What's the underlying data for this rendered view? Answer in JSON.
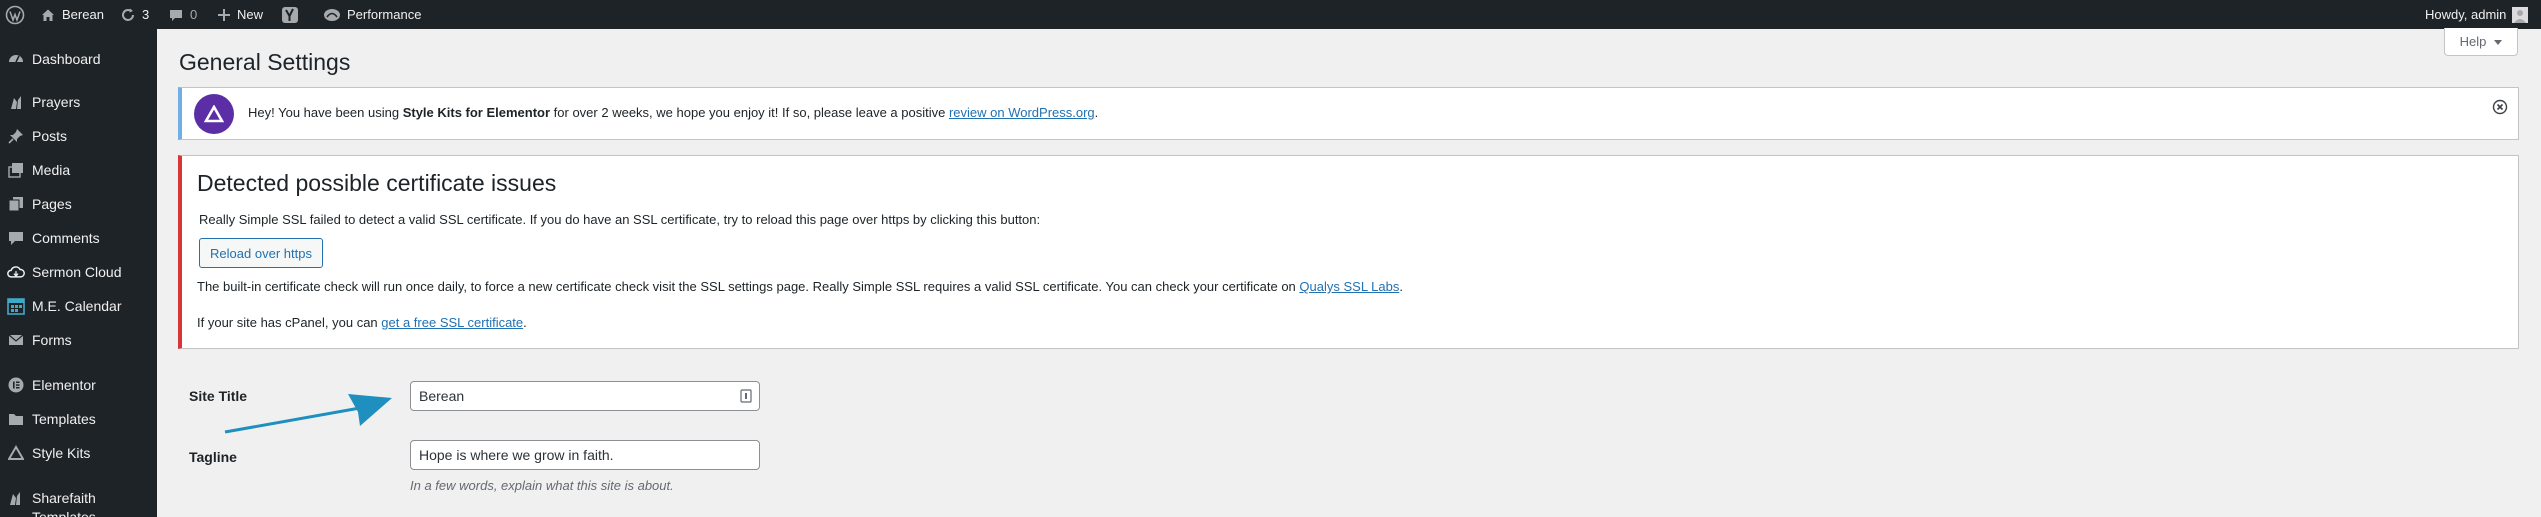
{
  "adminbar": {
    "site_name": "Berean",
    "updates_count": "3",
    "comments_count": "0",
    "new_label": "New",
    "performance_label": "Performance",
    "greeting": "Howdy, admin"
  },
  "sidebar": {
    "items": [
      {
        "label": "Dashboard",
        "icon": "dashboard-icon"
      },
      {
        "label": "Prayers",
        "icon": "prayers-icon"
      },
      {
        "label": "Posts",
        "icon": "pin-icon"
      },
      {
        "label": "Media",
        "icon": "media-icon"
      },
      {
        "label": "Pages",
        "icon": "pages-icon"
      },
      {
        "label": "Comments",
        "icon": "comments-icon"
      },
      {
        "label": "Sermon Cloud",
        "icon": "cloud-icon"
      },
      {
        "label": "M.E. Calendar",
        "icon": "calendar-icon"
      },
      {
        "label": "Forms",
        "icon": "envelope-icon"
      },
      {
        "label": "Elementor",
        "icon": "elementor-icon"
      },
      {
        "label": "Templates",
        "icon": "folder-icon"
      },
      {
        "label": "Style Kits",
        "icon": "triangle-icon"
      },
      {
        "label": "Sharefaith",
        "icon": "sharefaith-icon"
      },
      {
        "label": "Templates",
        "icon": "templates-icon"
      }
    ]
  },
  "page": {
    "title": "General Settings",
    "help_label": "Help"
  },
  "notice": {
    "text_before": "Hey! You have been using ",
    "plugin_name": "Style Kits for Elementor",
    "text_after": " for over 2 weeks, we hope you enjoy it! If so, please leave a positive ",
    "link_text": "review on WordPress.org",
    "text_end": "."
  },
  "ssl": {
    "title": "Detected possible certificate issues",
    "p1": "Really Simple SSL failed to detect a valid SSL certificate. If you do have an SSL certificate, try to reload this page over https by clicking this button:",
    "button_label": "Reload over https",
    "p2_text": "The built-in certificate check will run once daily, to force a new certificate check visit the SSL settings page. Really Simple SSL requires a valid SSL certificate. You can check your certificate on ",
    "p2_link": "Qualys SSL Labs",
    "p2_end": ".",
    "p3_text": "If your site has cPanel, you can ",
    "p3_link": "get a free SSL certificate",
    "p3_end": "."
  },
  "form": {
    "site_title_label": "Site Title",
    "site_title_value": "Berean",
    "tagline_label": "Tagline",
    "tagline_value": "Hope is where we grow in faith.",
    "tagline_description": "In a few words, explain what this site is about."
  },
  "colors": {
    "admin_dark": "#1d2327",
    "link_blue": "#2271b1",
    "error_red": "#d63638",
    "info_blue": "#72aee6",
    "annotation_arrow": "#1f8fc0"
  }
}
